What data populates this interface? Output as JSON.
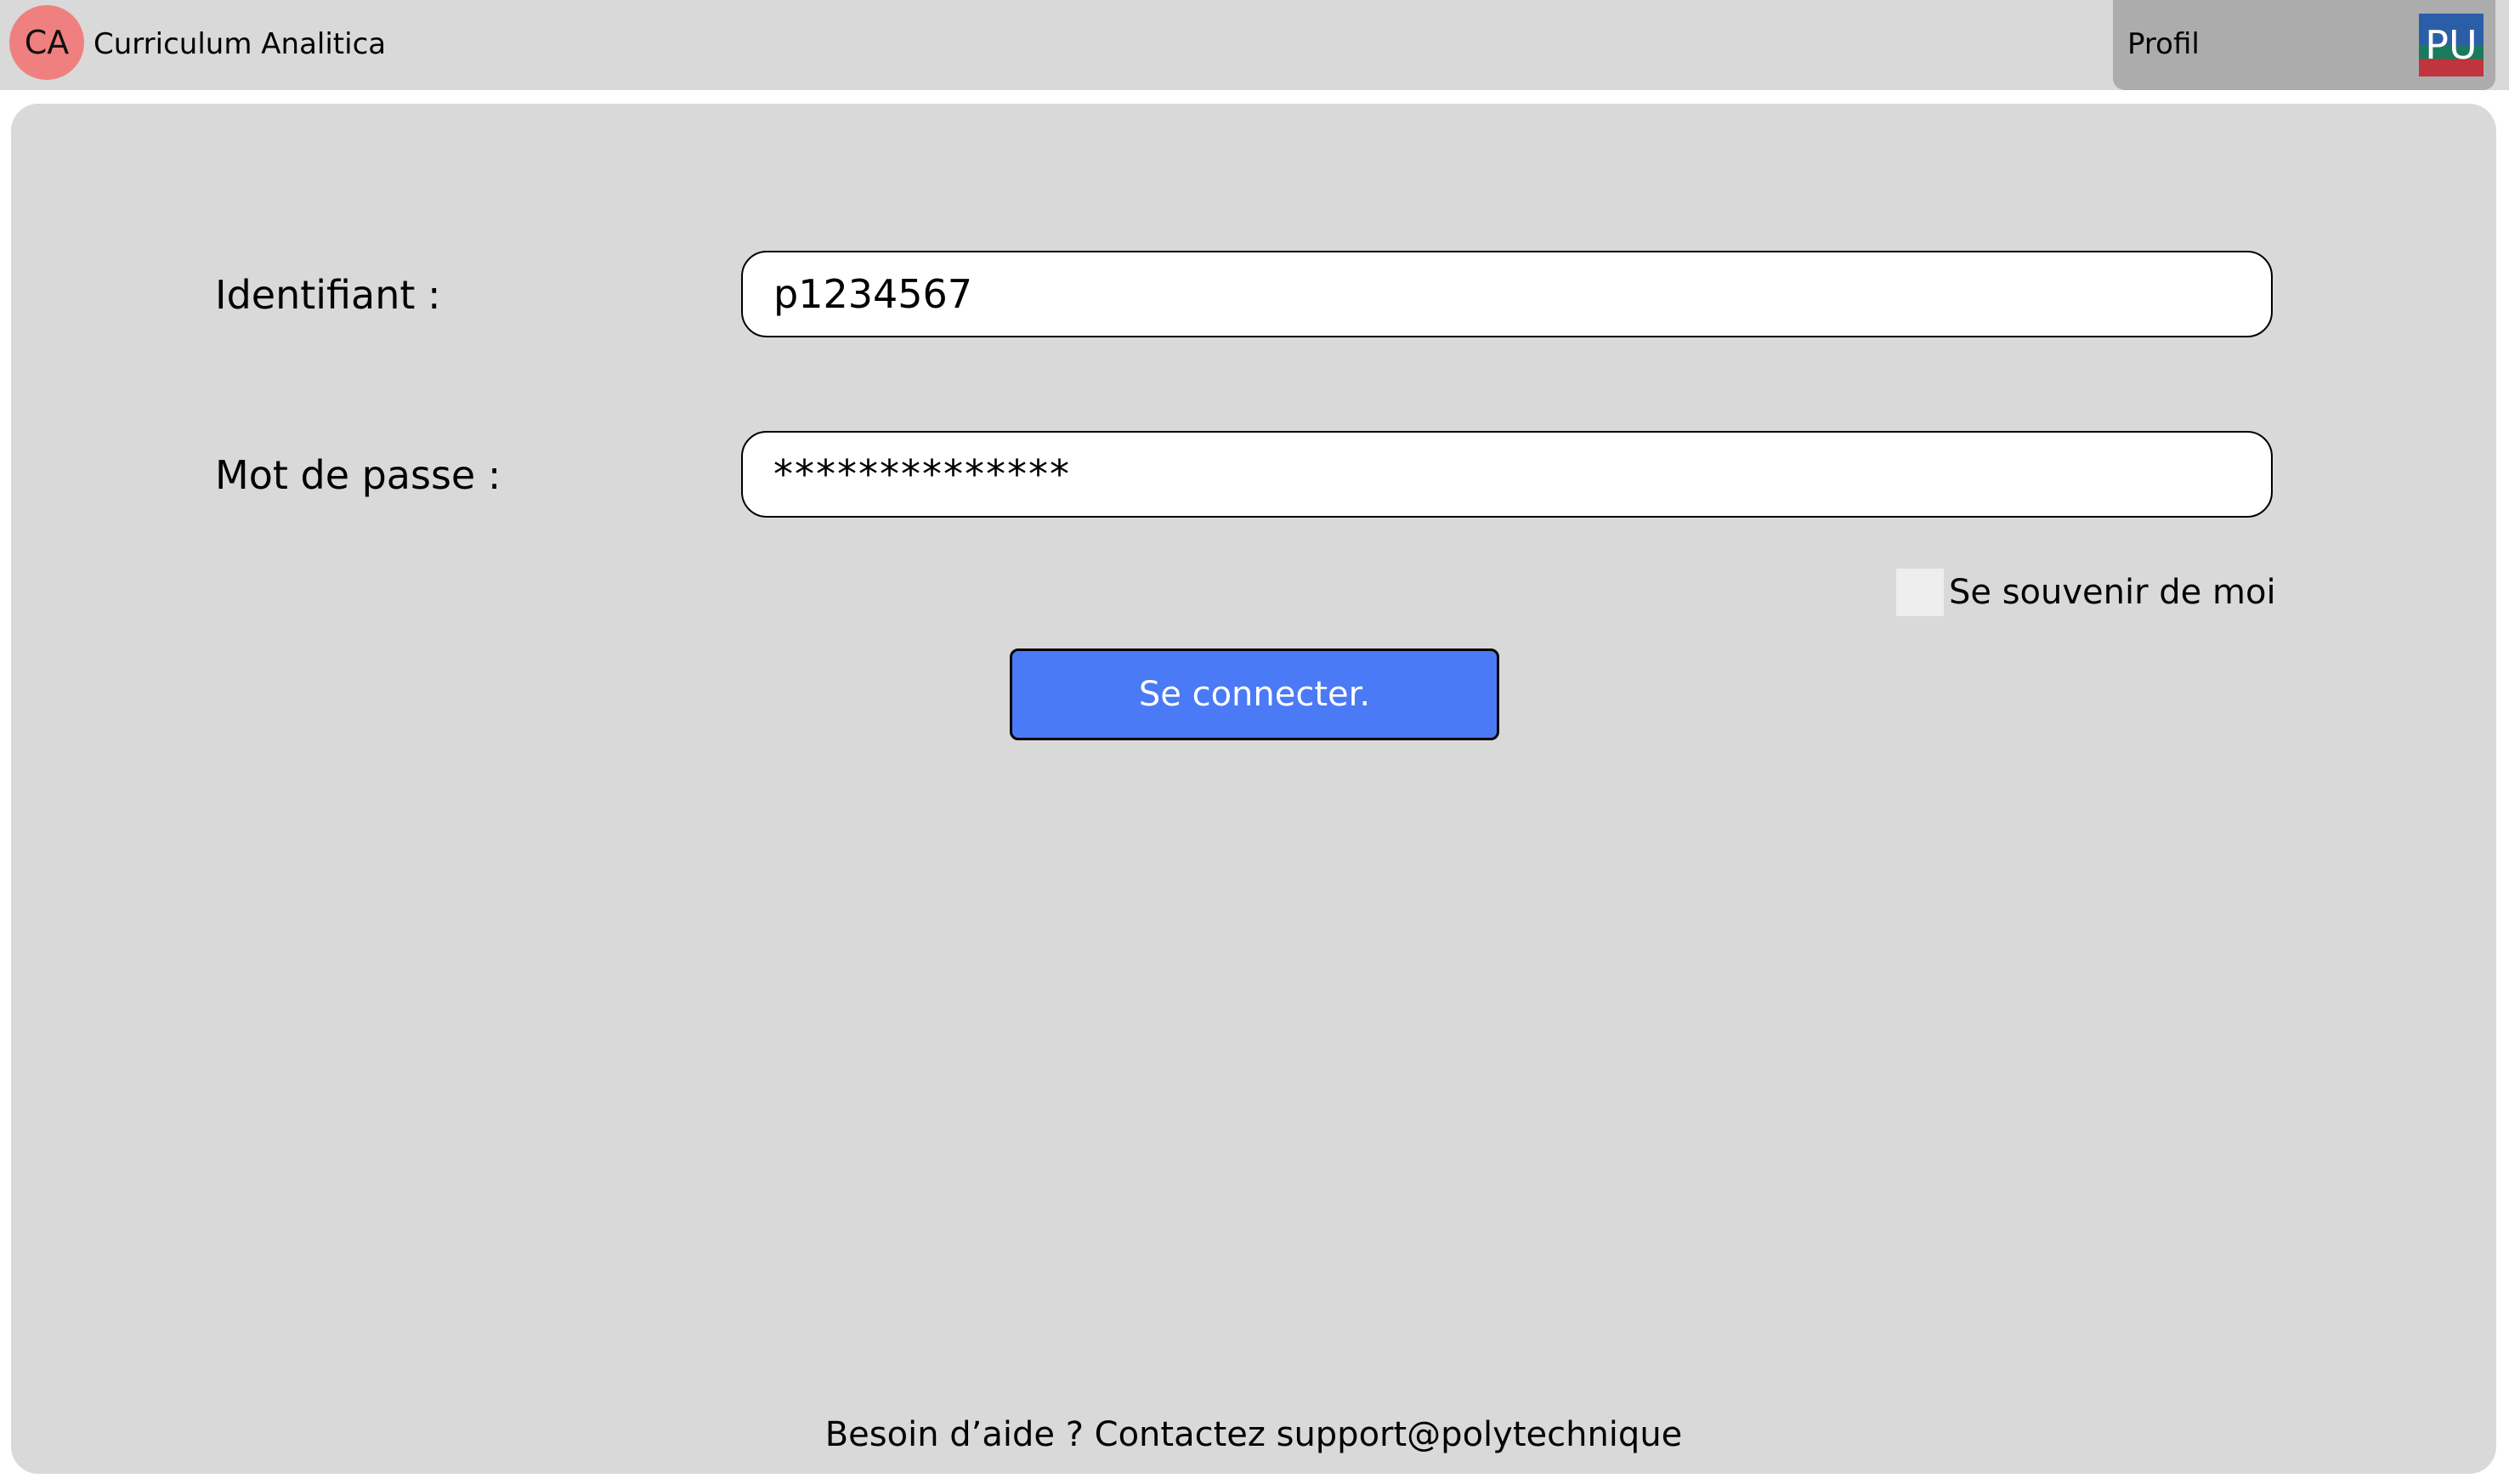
{
  "header": {
    "logo_text": "CA",
    "app_title": "Curriculum Analitica",
    "profile_label": "Profil",
    "avatar_text": "PU"
  },
  "login": {
    "username_label": "Identifiant :",
    "username_value": "p1234567",
    "password_label": "Mot de passe :",
    "password_value": "**************",
    "remember_label": "Se souvenir de moi",
    "remember_checked": false,
    "submit_label": "Se connecter."
  },
  "footer": {
    "help_text": "Besoin d’aide ? Contactez support@polytechnique"
  },
  "colors": {
    "background": "#d9d9d9",
    "logo": "#f08080",
    "profile_button": "#acacac",
    "primary_button": "#4a7af5"
  }
}
